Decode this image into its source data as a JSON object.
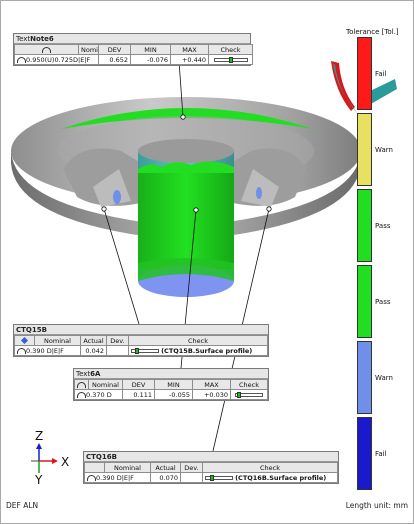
{
  "legend": {
    "title": "Tolerance [Tol.]",
    "segments": [
      {
        "label": "Fail",
        "color": "#ff1a1a"
      },
      {
        "label": "Warn",
        "color": "#e8e060"
      },
      {
        "label": "Pass",
        "color": "#22dd22"
      },
      {
        "label": "Pass",
        "color": "#22dd22"
      },
      {
        "label": "Warn",
        "color": "#6f8fe8"
      },
      {
        "label": "Fail",
        "color": "#1a1acc"
      }
    ]
  },
  "note6": {
    "title_prefix": "Text",
    "title_bold": "Note6",
    "headers": [
      "Nominal",
      "DEV",
      "MIN",
      "MAX",
      "Check"
    ],
    "nominal": "0.950(U)0.725",
    "datum": "D|E|F",
    "dev": "0.652",
    "min": "-0.076",
    "max": "+0.440",
    "check_position": 0.45
  },
  "ctq15b": {
    "title": "CTQ15B",
    "headers": [
      "Nominal",
      "Actual",
      "Dev.",
      "Check"
    ],
    "nominal": "0.390",
    "datum": "D|E|F",
    "actual": "0.042",
    "dev": "",
    "check_label": "(CTQ15B.Surface profile)",
    "check_position": 0.1
  },
  "text6a": {
    "title_prefix": "Text",
    "title_bold": "6A",
    "headers": [
      "Nominal",
      "DEV",
      "MIN",
      "MAX",
      "Check"
    ],
    "nominal": "0.370",
    "datum": "D",
    "dev": "0.111",
    "min": "-0.055",
    "max": "+0.030",
    "check_position": 0.05
  },
  "ctq16b": {
    "title": "CTQ16B",
    "headers": [
      "Nominal",
      "Actual",
      "Dev.",
      "Check"
    ],
    "nominal": "0.390",
    "datum": "D|E|F",
    "actual": "0.070",
    "dev": "",
    "check_label": "(CTQ16B.Surface profile)",
    "check_position": 0.15
  },
  "axes": {
    "z": "Z",
    "x": "X",
    "y": "Y"
  },
  "footer": {
    "alignment": "DEF ALN",
    "unit": "Length unit: mm"
  }
}
